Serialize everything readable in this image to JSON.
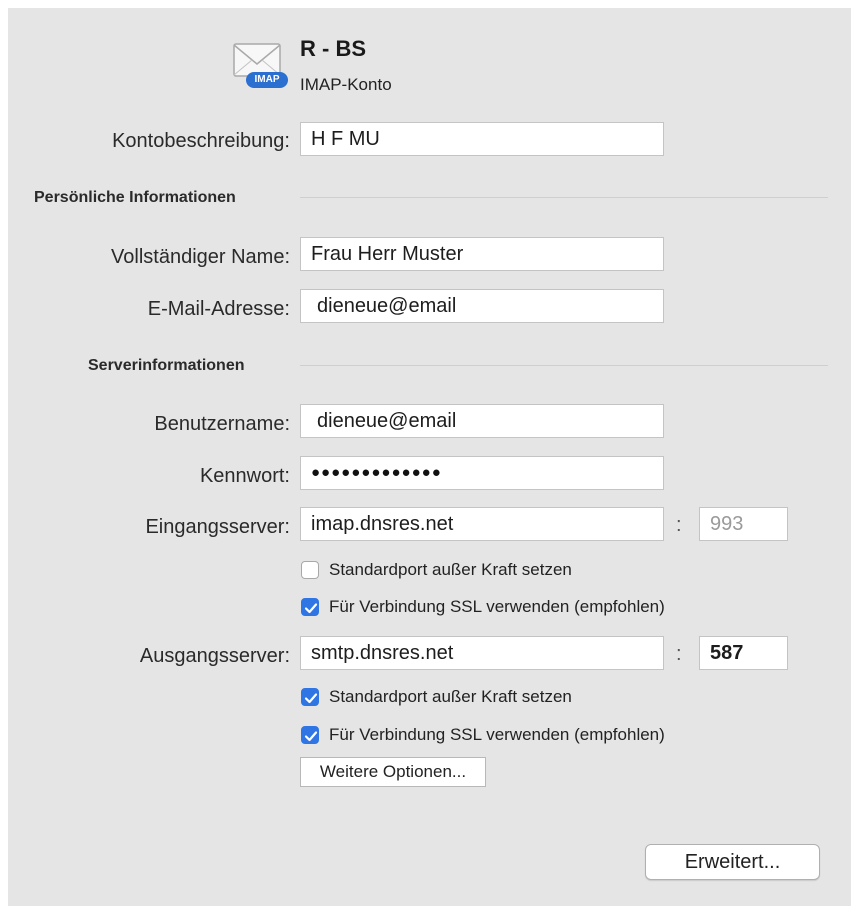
{
  "header": {
    "title": "R - BS",
    "subtitle": "IMAP-Konto",
    "icon": "imap-mail-icon",
    "icon_badge": "IMAP"
  },
  "account": {
    "description_label": "Kontobeschreibung:",
    "description_value": "H F MU"
  },
  "personal": {
    "section_title": "Persönliche Informationen",
    "name_label": "Vollständiger Name:",
    "name_value": "Frau Herr Muster",
    "email_label": "E-Mail-Adresse:",
    "email_value": "dieneue@email"
  },
  "server": {
    "section_title": "Serverinformationen",
    "username_label": "Benutzername:",
    "username_value": "dieneue@email",
    "password_label": "Kennwort:",
    "password_value": "●●●●●●●●●●●●●",
    "incoming_label": "Eingangsserver:",
    "incoming_value": "imap.dnsres.net",
    "incoming_colon": ":",
    "incoming_port_placeholder": "993",
    "incoming_override_label": "Standardport außer Kraft setzen",
    "incoming_override_checked": false,
    "incoming_ssl_label": "Für Verbindung SSL verwenden (empfohlen)",
    "incoming_ssl_checked": true,
    "outgoing_label": "Ausgangsserver:",
    "outgoing_value": "smtp.dnsres.net",
    "outgoing_colon": ":",
    "outgoing_port_value": "587",
    "outgoing_override_label": "Standardport außer Kraft setzen",
    "outgoing_override_checked": true,
    "outgoing_ssl_label": "Für Verbindung SSL verwenden (empfohlen)",
    "outgoing_ssl_checked": true,
    "more_options_label": "Weitere Optionen..."
  },
  "footer": {
    "advanced_label": "Erweitert..."
  },
  "colors": {
    "panel_bg": "#e5e5e5",
    "checkbox_accent": "#2f76e4"
  }
}
